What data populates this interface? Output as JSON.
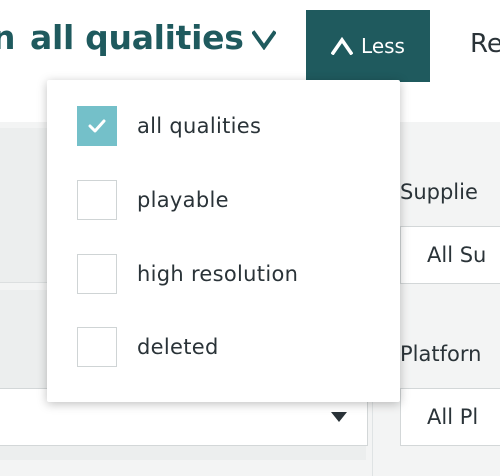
{
  "header": {
    "prefix_fragment": "n",
    "quality_select": {
      "label": "all qualities",
      "icon": "chevron-down-icon"
    },
    "less_button": {
      "label": "Less",
      "icon": "chevron-up-icon"
    },
    "right_fragment": "Re"
  },
  "quality_popover": {
    "options": [
      {
        "label": "all qualities",
        "checked": true
      },
      {
        "label": "playable",
        "checked": false
      },
      {
        "label": "high resolution",
        "checked": false
      },
      {
        "label": "deleted",
        "checked": false
      }
    ]
  },
  "filters": {
    "supplier": {
      "label": "Supplie",
      "value": "All Su"
    },
    "platform": {
      "label": "Platforn",
      "value": "All Pl"
    }
  },
  "colors": {
    "brand": "#1f5a5e",
    "checkbox_checked": "#74c0c9",
    "panel_bg": "#f3f4f4"
  }
}
